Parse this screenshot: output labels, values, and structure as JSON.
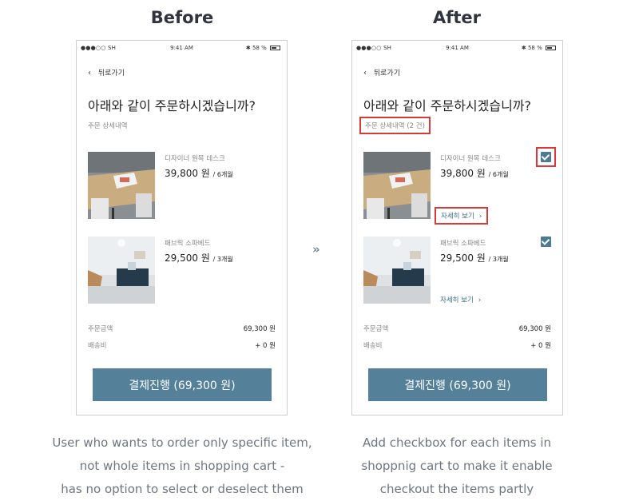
{
  "panels": {
    "before": {
      "title": "Before",
      "caption": [
        "User who wants to order only specific item,",
        "not whole items in shopping cart -",
        "has no option to select or deselect them"
      ]
    },
    "after": {
      "title": "After",
      "caption": [
        "Add checkbox for each items in",
        "shoppnig cart to make it enable",
        "checkout the items partly"
      ]
    },
    "arrow": "»"
  },
  "phone": {
    "status": {
      "carrier": "●●●○○ SH",
      "time": "9:41 AM",
      "battery": "58 %"
    },
    "back_label": "뒤로가기",
    "headline": "아래와 같이 주문하시겠습니까?",
    "subhead_before": "주문 상세내역",
    "subhead_after": "주문 상세내역 (2 건)",
    "items": [
      {
        "name": "디자이너 원목 데스크",
        "price": "39,800 원",
        "period": "/ 6개월",
        "checked": true
      },
      {
        "name": "패브릭 소파베드",
        "price": "29,500 원",
        "period": "/ 3개월",
        "checked": true
      }
    ],
    "detail_label": "자세히 보기",
    "summary": [
      {
        "label": "주문금액",
        "value": "69,300 원"
      },
      {
        "label": "배송비",
        "value": "+ 0 원"
      }
    ],
    "pay_button": "결제진행 (69,300 원)"
  },
  "colors": {
    "accent": "#54809a",
    "highlight": "#d83a3a",
    "title": "#2f3440"
  }
}
